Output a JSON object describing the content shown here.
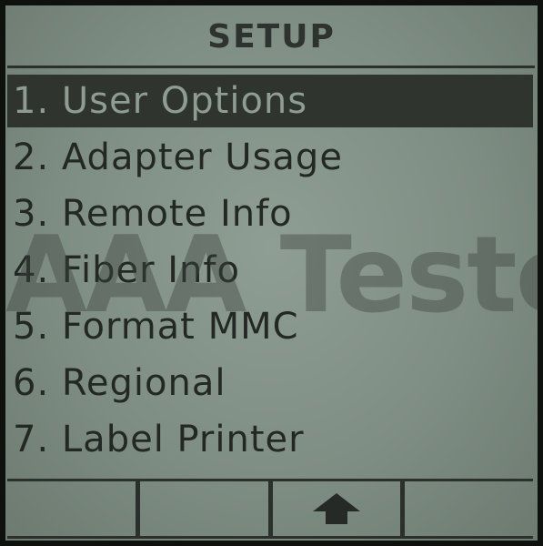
{
  "screen": {
    "title": "SETUP"
  },
  "menu": {
    "selected_index": 0,
    "items": [
      {
        "num": "1.",
        "label": "User Options"
      },
      {
        "num": "2.",
        "label": "Adapter Usage"
      },
      {
        "num": "3.",
        "label": "Remote Info"
      },
      {
        "num": "4.",
        "label": "Fiber Info"
      },
      {
        "num": "5.",
        "label": "Format MMC"
      },
      {
        "num": "6.",
        "label": "Regional"
      },
      {
        "num": "7.",
        "label": "Label Printer"
      }
    ]
  },
  "softkeys": [
    {
      "label": "",
      "icon": ""
    },
    {
      "label": "",
      "icon": ""
    },
    {
      "label": "",
      "icon": "up-arrow-icon"
    },
    {
      "label": "",
      "icon": ""
    }
  ],
  "watermark": {
    "text": "AAA Testers"
  },
  "colors": {
    "lcd_background": "#8f9e94",
    "lcd_text": "#242824",
    "selection_bar": "#2f342f"
  }
}
